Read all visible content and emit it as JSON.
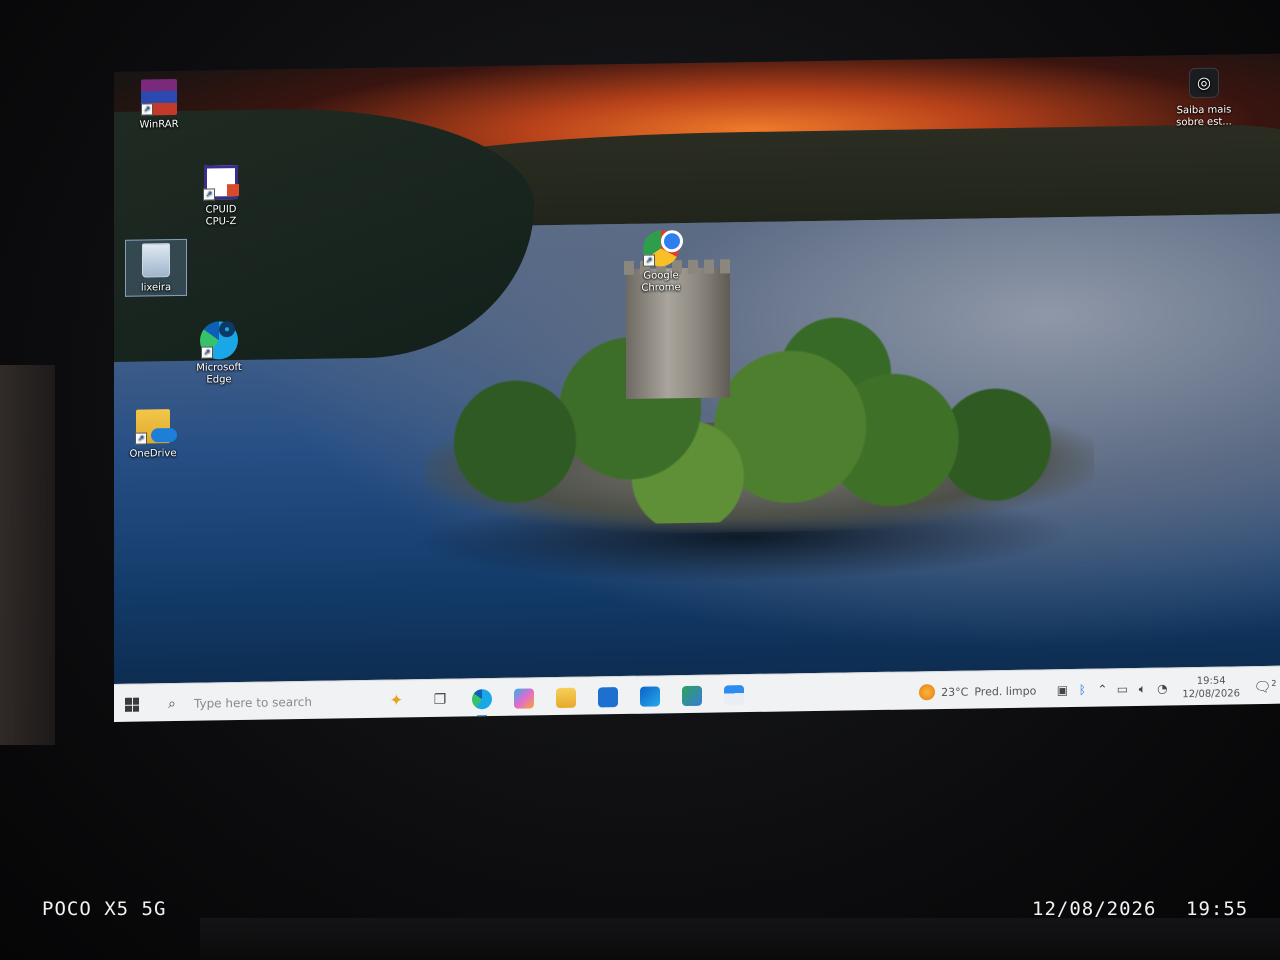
{
  "desktop": {
    "icons": [
      {
        "id": "winrar",
        "label": "WinRAR"
      },
      {
        "id": "cpuz",
        "label": "CPUID\nCPU-Z"
      },
      {
        "id": "recycle_bin",
        "label": "lixeira"
      },
      {
        "id": "edge",
        "label": "Microsoft\nEdge"
      },
      {
        "id": "onedrive",
        "label": "OneDrive"
      },
      {
        "id": "chrome",
        "label": "Google\nChrome"
      },
      {
        "id": "feedback",
        "label": "Saiba mais\nsobre est..."
      }
    ]
  },
  "taskbar": {
    "search_placeholder": "Type here to search",
    "pinned": [
      "task-view-icon",
      "edge-icon",
      "copilot-icon",
      "file-explorer-icon",
      "store-icon",
      "outlook-icon",
      "news-icon",
      "calculator-icon"
    ],
    "weather": {
      "temp": "23°C",
      "desc": "Pred. limpo"
    },
    "clock": {
      "time": "19:54",
      "date": "12/08/2026"
    },
    "notification_count": "2"
  },
  "photo_watermark": {
    "device": "POCO X5 5G",
    "date": "12/08/2026",
    "time": "19:55"
  },
  "colors": {
    "taskbar_bg": "#f1f2f4",
    "accent": "#3b7bd8"
  }
}
